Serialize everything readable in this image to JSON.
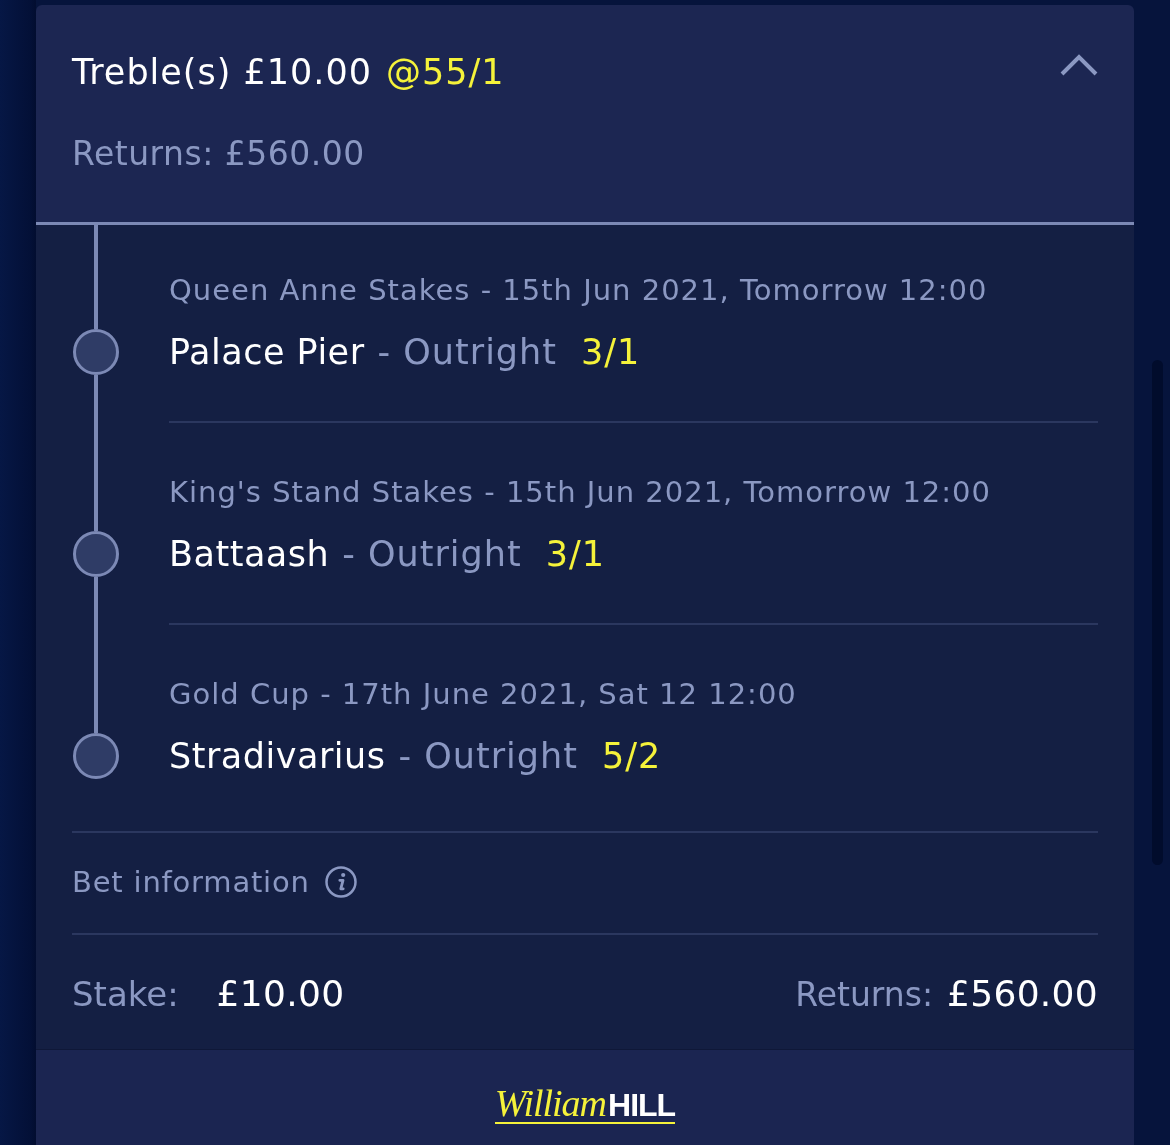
{
  "bet": {
    "title": "Treble(s) £10.00",
    "odds": "@55/1",
    "expanded": true,
    "returns": "Returns: £560.00"
  },
  "legs": [
    {
      "event": "Queen Anne Stakes - 15th Jun 2021, Tomorrow 12:00",
      "selection": "Palace Pier",
      "market": "- Outright",
      "odds": "3/1"
    },
    {
      "event": "King's Stand Stakes - 15th Jun 2021, Tomorrow 12:00",
      "selection": "Battaash",
      "market": "- Outright",
      "odds": "3/1"
    },
    {
      "event": "Gold Cup - 17th June 2021, Sat 12 12:00",
      "selection": "Stradivarius",
      "market": "- Outright",
      "odds": "5/2"
    }
  ],
  "bet_information": {
    "label": "Bet information"
  },
  "summary": {
    "stake_label": "Stake:",
    "stake": "£10.00",
    "returns_label": "Returns:",
    "returns": "£560.00"
  },
  "footer": {
    "logo_script": "William",
    "logo_bold": "HILL"
  }
}
